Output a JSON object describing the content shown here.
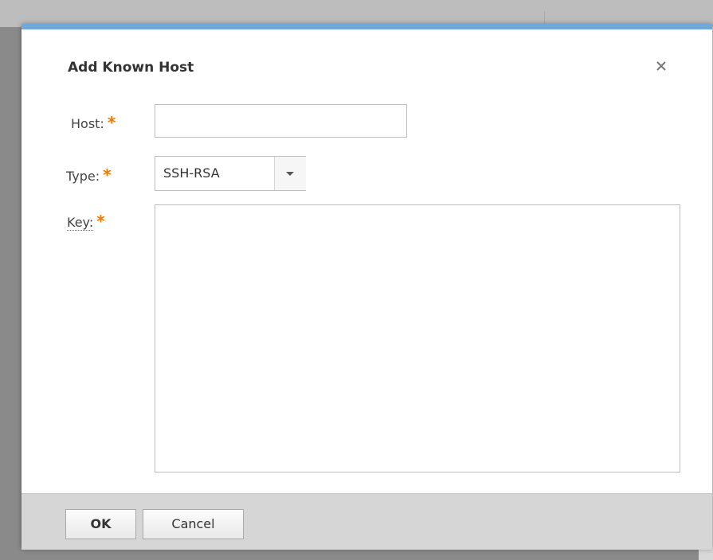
{
  "dialog": {
    "title": "Add Known Host",
    "close_icon": "close-icon",
    "accent_color": "#6fa8d9",
    "required_color": "#f07800"
  },
  "form": {
    "host": {
      "label": "Host:",
      "required_mark": "*",
      "value": ""
    },
    "type": {
      "label": "Type:",
      "required_mark": "*",
      "selected": "SSH-RSA",
      "icon": "chevron-down-icon"
    },
    "key": {
      "label": "Key:",
      "required_mark": "*",
      "value": ""
    }
  },
  "footer": {
    "ok_label": "OK",
    "cancel_label": "Cancel"
  }
}
